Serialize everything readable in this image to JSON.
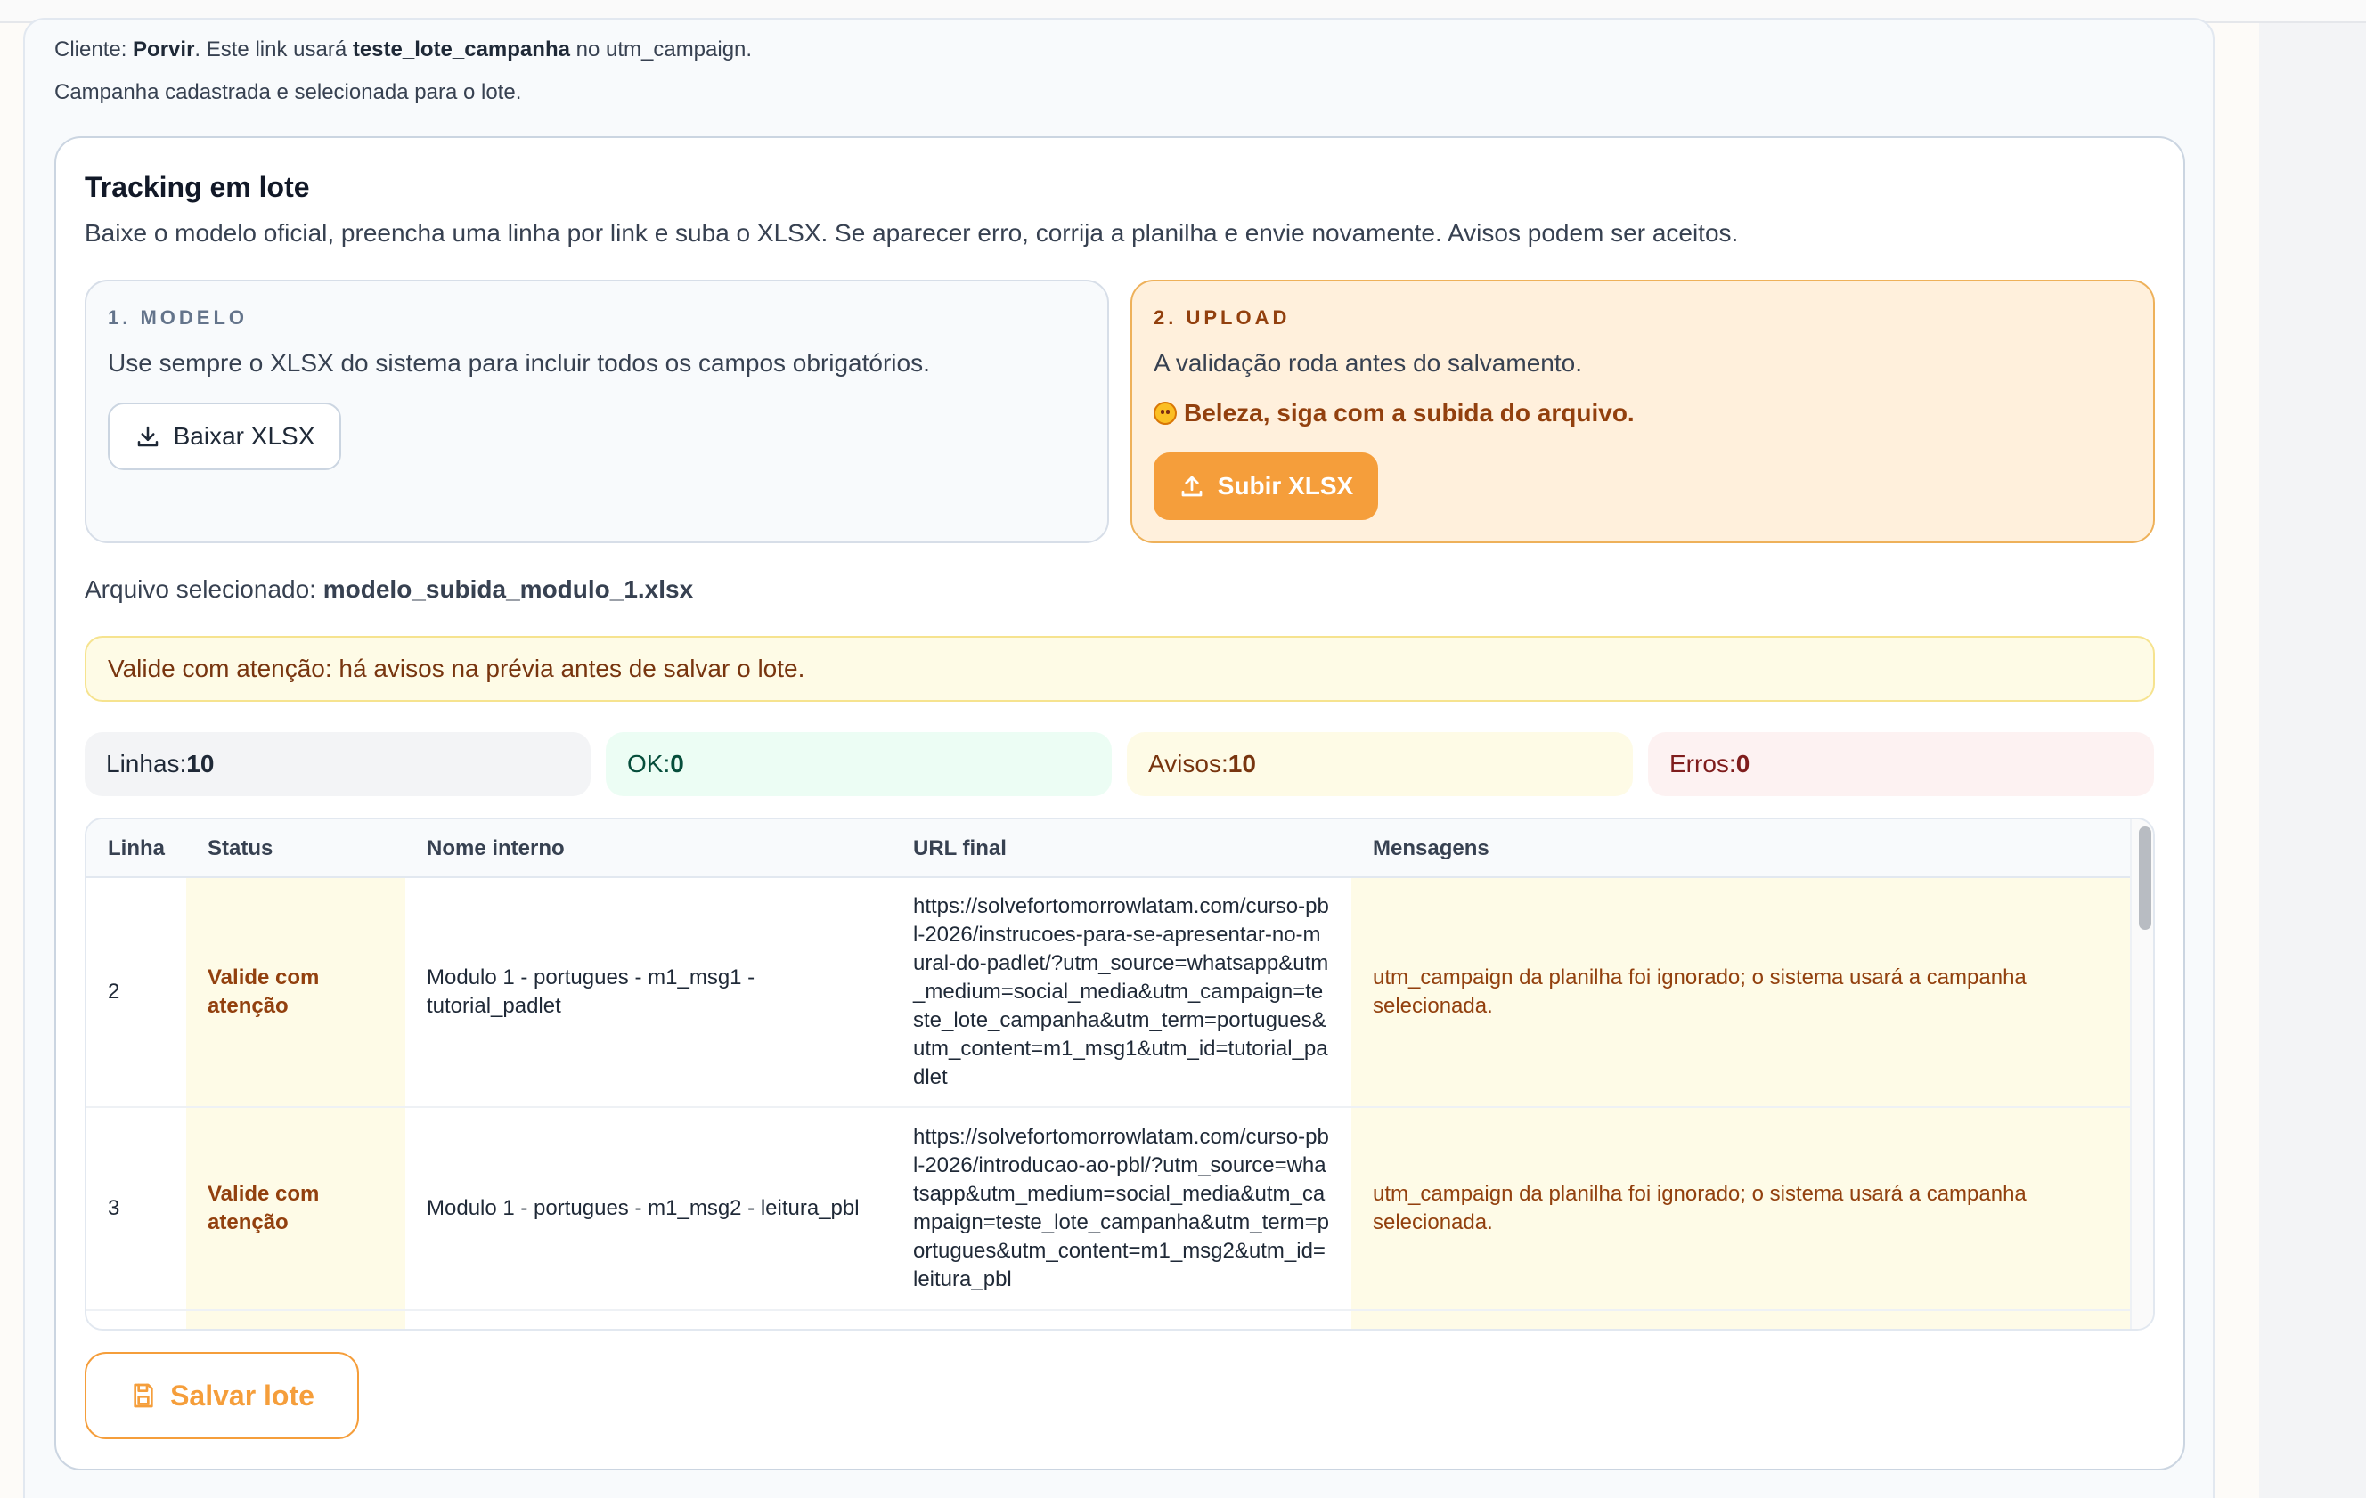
{
  "context": {
    "client_prefix": "Cliente: ",
    "client_name": "Porvir",
    "client_mid": ". Este link usará ",
    "campaign": "teste_lote_campanha",
    "client_suffix": " no utm_campaign.",
    "campaign_note": "Campanha cadastrada e selecionada para o lote."
  },
  "panel": {
    "title": "Tracking em lote",
    "description": "Baixe o modelo oficial, preencha uma linha por link e suba o XLSX. Se aparecer erro, corrija a planilha e envie novamente. Avisos podem ser aceitos."
  },
  "step_model": {
    "label": "1. MODELO",
    "text": "Use sempre o XLSX do sistema para incluir todos os campos obrigatórios.",
    "button": "Baixar XLSX",
    "icon": "download-icon"
  },
  "step_upload": {
    "label": "2. UPLOAD",
    "text": "A validação roda antes do salvamento.",
    "hint": "Beleza, siga com a subida do arquivo.",
    "hint_icon": "smile-emoji-icon",
    "button": "Subir XLSX",
    "icon": "upload-icon"
  },
  "file": {
    "label": "Arquivo selecionado: ",
    "name": "modelo_subida_modulo_1.xlsx"
  },
  "banner": {
    "text": "Valide com atenção: há avisos na prévia antes de salvar o lote."
  },
  "stats": {
    "lines_label": "Linhas: ",
    "lines_value": "10",
    "ok_label": "OK: ",
    "ok_value": "0",
    "warn_label": "Avisos: ",
    "warn_value": "10",
    "err_label": "Erros: ",
    "err_value": "0"
  },
  "table": {
    "columns": [
      "Linha",
      "Status",
      "Nome interno",
      "URL final",
      "Mensagens"
    ],
    "rows": [
      {
        "line": "2",
        "status": "Valide com atenção",
        "name": "Modulo 1 - portugues - m1_msg1 - tutorial_padlet",
        "url": "https://solvefortomorrowlatam.com/curso-pbl-2026/instrucoes-para-se-apresentar-no-mural-do-padlet/?utm_source=whatsapp&utm_medium=social_media&utm_campaign=teste_lote_campanha&utm_term=portugues&utm_content=m1_msg1&utm_id=tutorial_padlet",
        "message": "utm_campaign da planilha foi ignorado; o sistema usará a campanha selecionada."
      },
      {
        "line": "3",
        "status": "Valide com atenção",
        "name": "Modulo 1 - portugues - m1_msg2 - leitura_pbl",
        "url": "https://solvefortomorrowlatam.com/curso-pbl-2026/introducao-ao-pbl/?utm_source=whatsapp&utm_medium=social_media&utm_campaign=teste_lote_campanha&utm_term=portugues&utm_content=m1_msg2&utm_id=leitura_pbl",
        "message": "utm_campaign da planilha foi ignorado; o sistema usará a campanha selecionada."
      }
    ]
  },
  "save": {
    "button": "Salvar lote",
    "icon": "save-icon"
  },
  "colors": {
    "accent_orange": "#f59e3b",
    "warning_text": "#92400e",
    "warning_bg": "#fefbe7"
  }
}
